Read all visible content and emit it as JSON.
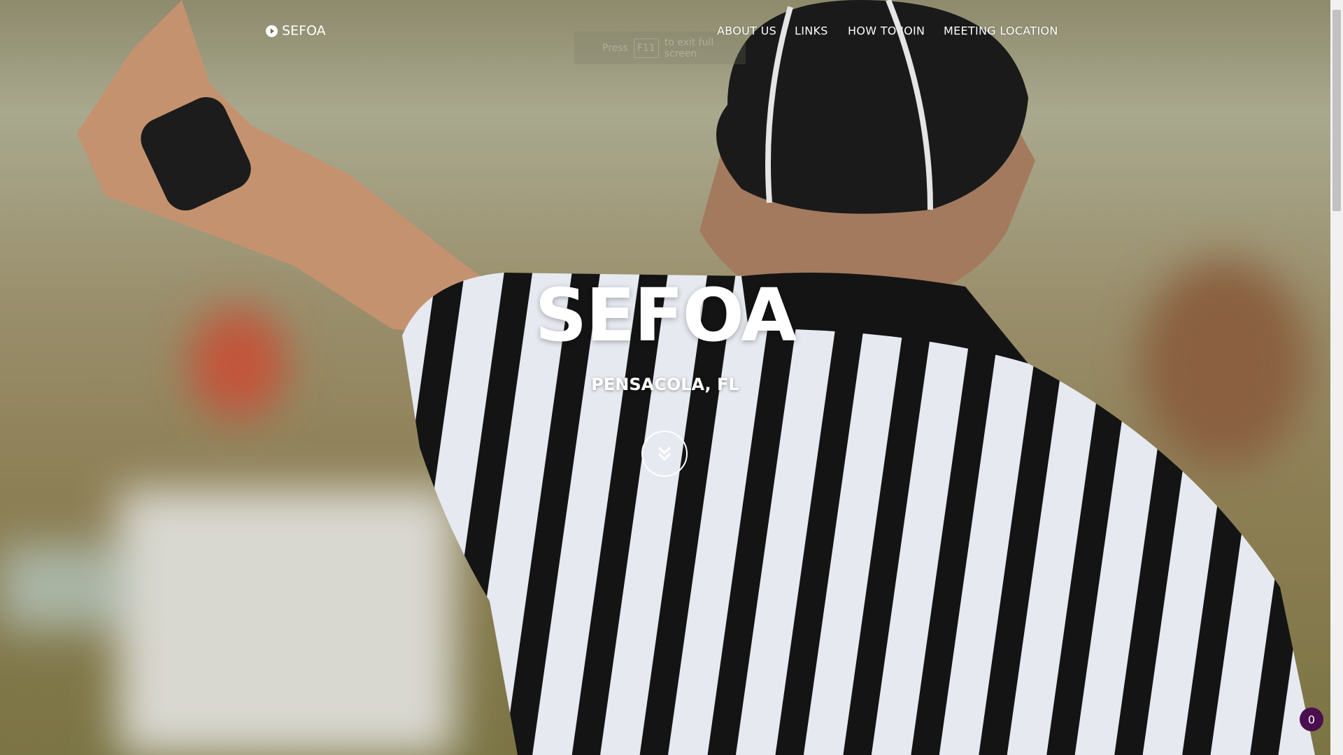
{
  "header": {
    "logo_text": "SEFOA",
    "logo_icon": "play-circle-icon",
    "nav": [
      {
        "label": "ABOUT US"
      },
      {
        "label": "LINKS"
      },
      {
        "label": "HOW TO JOIN"
      },
      {
        "label": "MEETING LOCATION"
      }
    ]
  },
  "fullscreen_notice": {
    "before": "Press",
    "key": "F11",
    "after": "to exit full screen"
  },
  "hero": {
    "title": "SEFOA",
    "subtitle": "PENSACOLA, FL",
    "scroll_icon": "double-chevron-down-icon"
  },
  "notification_badge": {
    "count": "0",
    "color": "#4a0f4e"
  }
}
